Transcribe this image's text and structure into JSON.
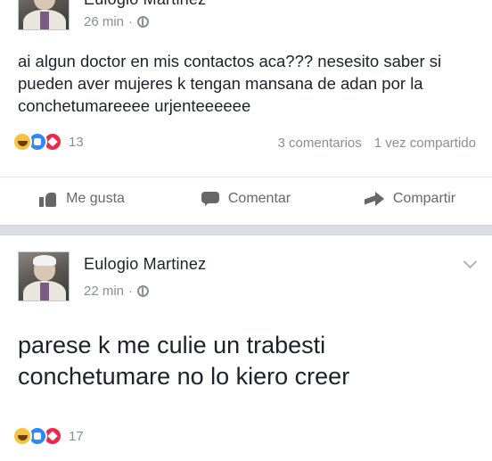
{
  "post1": {
    "author": "Eulogio Martinez",
    "time": "26 min",
    "separator": "·",
    "text": "ai algun doctor en mis contactos aca??? nesesito saber si pueden aver mujeres k tengan mansana de adan por la conchetumareeee urjenteeeeee",
    "reaction_count": "13",
    "comments": "3 comentarios",
    "shares": "1 vez compartido",
    "actions": {
      "like": "Me gusta",
      "comment": "Comentar",
      "share": "Compartir"
    }
  },
  "post2": {
    "author": "Eulogio Martinez",
    "time": "22 min",
    "separator": "·",
    "text": "parese k me culie un trabesti conchetumare no lo kiero creer",
    "reaction_count": "17"
  },
  "icons": {
    "reactions": [
      "haha-reaction-icon",
      "like-reaction-icon",
      "love-reaction-icon"
    ],
    "privacy": "globe-icon",
    "menu": "chevron-down-icon",
    "like": "thumbs-up-icon",
    "comment": "comment-icon",
    "share": "share-arrow-icon"
  },
  "colors": {
    "accent": "#2d88ff",
    "love": "#f0284a",
    "haha": "#f7c33b",
    "muted_text": "#8a8d91"
  }
}
